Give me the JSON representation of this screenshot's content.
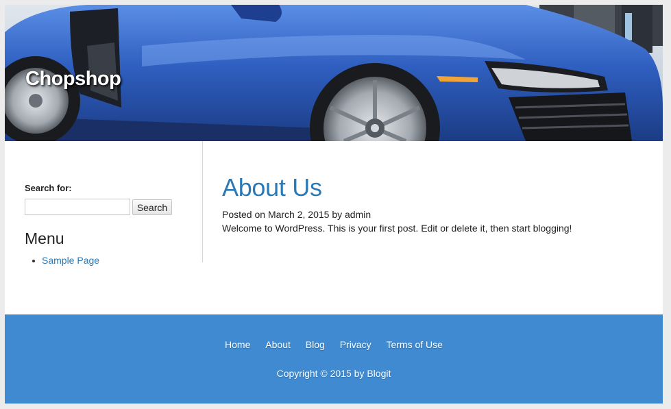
{
  "header": {
    "site_title": "Chopshop"
  },
  "sidebar": {
    "search_label": "Search for:",
    "search_value": "",
    "search_button": "Search",
    "menu_heading": "Menu",
    "menu_items": [
      {
        "label": "Sample Page"
      }
    ]
  },
  "post": {
    "title": "About Us",
    "meta": "Posted on March 2, 2015 by admin",
    "body": "Welcome to WordPress. This is your first post. Edit or delete it, then start blogging!"
  },
  "footer": {
    "nav": [
      {
        "label": "Home"
      },
      {
        "label": "About"
      },
      {
        "label": "Blog"
      },
      {
        "label": "Privacy"
      },
      {
        "label": "Terms of Use"
      }
    ],
    "copyright": "Copyright © 2015 by Blogit"
  },
  "colors": {
    "link": "#2a7ab8",
    "footer_bg": "#3f8ad0",
    "car_body": "#2f5fc0"
  },
  "hero_image": "blue-sports-car"
}
